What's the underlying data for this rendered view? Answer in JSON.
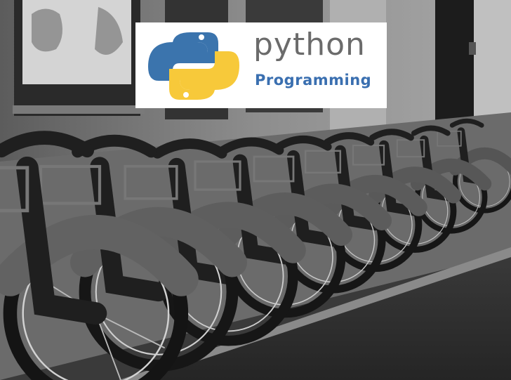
{
  "logo": {
    "word": "python",
    "subtitle": "Programming",
    "colors": {
      "blue": "#3b74ad",
      "yellow": "#f7c93a",
      "word": "#6b6b6b",
      "subtitle": "#3a6fb0"
    }
  },
  "photo": {
    "colors": {
      "street": "#2f2f2f",
      "sidewalk": "#6e6e6e",
      "building": "#9a9a9a",
      "bike_frame": "#1e1e1e",
      "fender": "#5a5a5a"
    }
  }
}
